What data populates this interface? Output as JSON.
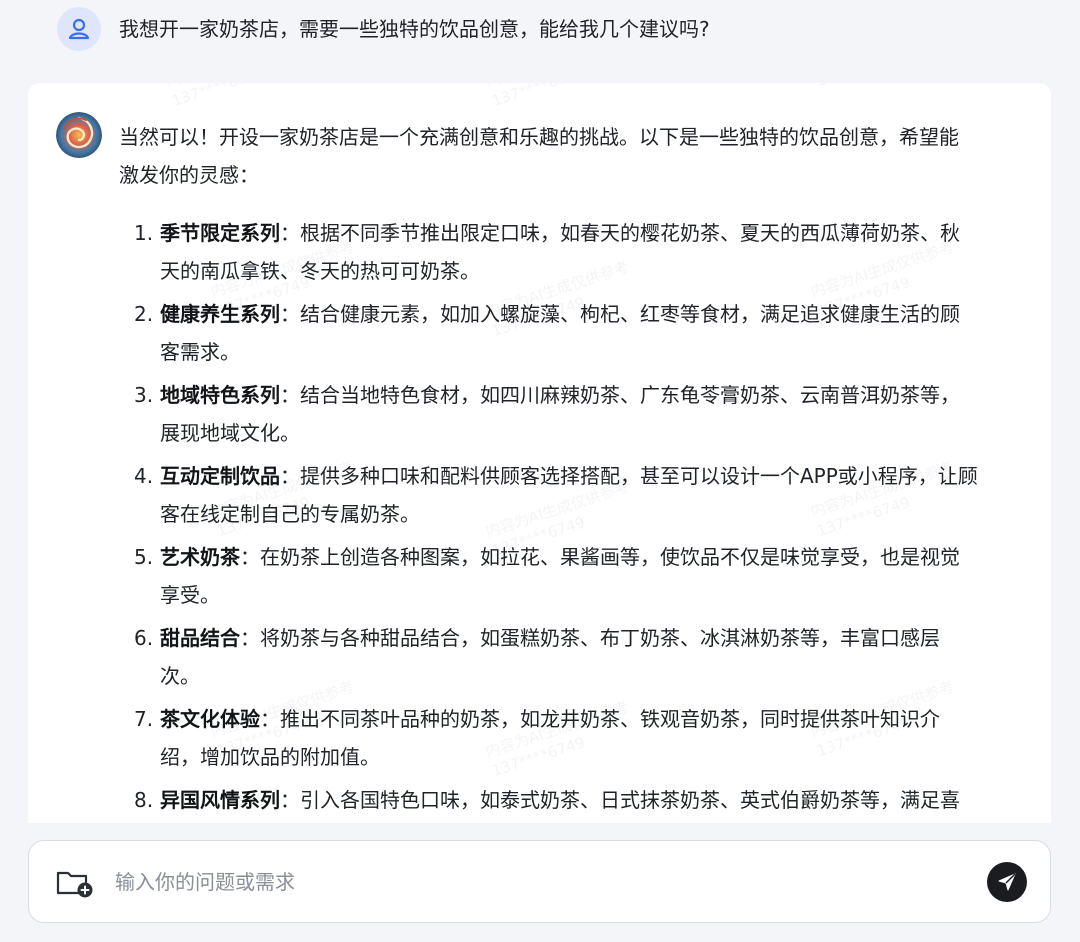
{
  "user": {
    "avatar_icon": "user-icon",
    "question": "我想开一家奶茶店，需要一些独特的饮品创意，能给我几个建议吗?"
  },
  "answer": {
    "avatar_icon": "ai-swirl-avatar",
    "intro_line1": "当然可以！开设一家奶茶店是一个充满创意和乐趣的挑战。以下是一些独特的饮品创意，希望能",
    "intro_line2": "激发你的灵感：",
    "items": [
      {
        "num": "1.",
        "title": "季节限定系列",
        "l1": "：根据不同季节推出限定口味，如春天的樱花奶茶、夏天的西瓜薄荷奶茶、秋",
        "l2": "天的南瓜拿铁、冬天的热可可奶茶。"
      },
      {
        "num": "2.",
        "title": "健康养生系列",
        "l1": "：结合健康元素，如加入螺旋藻、枸杞、红枣等食材，满足追求健康生活的顾",
        "l2": "客需求。"
      },
      {
        "num": "3.",
        "title": "地域特色系列",
        "l1": "：结合当地特色食材，如四川麻辣奶茶、广东龟苓膏奶茶、云南普洱奶茶等，",
        "l2": "展现地域文化。"
      },
      {
        "num": "4.",
        "title": "互动定制饮品",
        "l1": "：提供多种口味和配料供顾客选择搭配，甚至可以设计一个APP或小程序，让顾",
        "l2": "客在线定制自己的专属奶茶。"
      },
      {
        "num": "5.",
        "title": "艺术奶茶",
        "l1": "：在奶茶上创造各种图案，如拉花、果酱画等，使饮品不仅是味觉享受，也是视觉",
        "l2": "享受。"
      },
      {
        "num": "6.",
        "title": "甜品结合",
        "l1": "：将奶茶与各种甜品结合，如蛋糕奶茶、布丁奶茶、冰淇淋奶茶等，丰富口感层",
        "l2": "次。"
      },
      {
        "num": "7.",
        "title": "茶文化体验",
        "l1": "：推出不同茶叶品种的奶茶，如龙井奶茶、铁观音奶茶，同时提供茶叶知识介",
        "l2": "绍，增加饮品的附加值。"
      },
      {
        "num": "8.",
        "title": "异国风情系列",
        "l1": "：引入各国特色口味，如泰式奶茶、日式抹茶奶茶、英式伯爵奶茶等，满足喜",
        "l2": ""
      }
    ]
  },
  "input": {
    "attach_icon": "folder-add-icon",
    "placeholder": "输入你的问题或需求",
    "send_icon": "send-icon"
  },
  "watermark": {
    "line1": "内容为AI生成仅供参考",
    "line2": "137****6749"
  }
}
